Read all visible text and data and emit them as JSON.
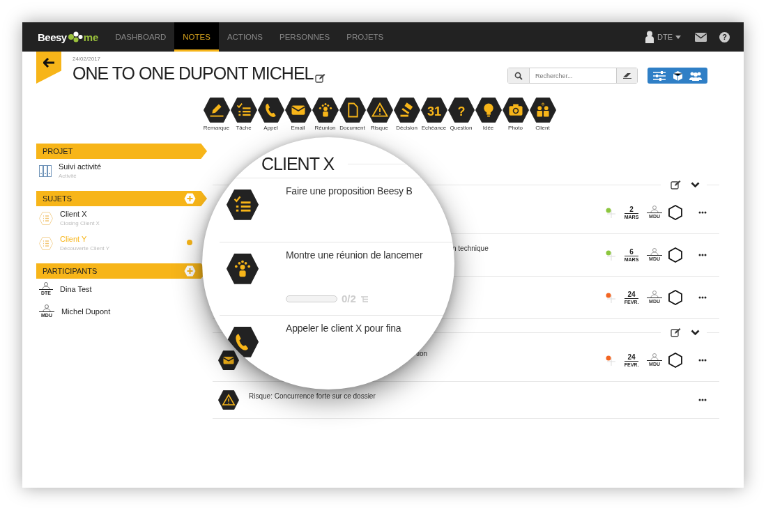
{
  "nav": {
    "logo_left": "Beesy",
    "logo_right": "me",
    "tabs": [
      {
        "label": "DASHBOARD",
        "selected": false
      },
      {
        "label": "NOTES",
        "selected": true
      },
      {
        "label": "ACTIONS",
        "selected": false
      },
      {
        "label": "PERSONNES",
        "selected": false
      },
      {
        "label": "PROJETS",
        "selected": false
      }
    ],
    "user": "DTE",
    "help_glyph": "?"
  },
  "header": {
    "date": "24/02/2017",
    "title": "ONE TO ONE DUPONT MICHEL",
    "search_placeholder": "Rechercher..."
  },
  "note_types": [
    {
      "kind": "remark",
      "label": "Remarque"
    },
    {
      "kind": "task",
      "label": "Tâche"
    },
    {
      "kind": "call",
      "label": "Appel"
    },
    {
      "kind": "email",
      "label": "Email"
    },
    {
      "kind": "meeting",
      "label": "Réunion"
    },
    {
      "kind": "document",
      "label": "Document"
    },
    {
      "kind": "risk",
      "label": "Risque"
    },
    {
      "kind": "decision",
      "label": "Décision"
    },
    {
      "kind": "deadline",
      "label": "Echéance",
      "glyph": "31"
    },
    {
      "kind": "question",
      "label": "Question",
      "glyph": "?"
    },
    {
      "kind": "idea",
      "label": "Idée"
    },
    {
      "kind": "photo",
      "label": "Photo"
    },
    {
      "kind": "client",
      "label": "Client"
    }
  ],
  "sidebar": {
    "sections": [
      {
        "title": "PROJET",
        "addable": false,
        "items": [
          {
            "kind": "project",
            "name": "Suivi activité",
            "subtitle": "Activité",
            "selected": false
          }
        ]
      },
      {
        "title": "SUJETS",
        "addable": true,
        "items": [
          {
            "kind": "subject",
            "name": "Client X",
            "subtitle": "Closing Client X",
            "selected": false
          },
          {
            "kind": "subject",
            "name": "Client Y",
            "subtitle": "Découverte Client Y",
            "selected": true
          }
        ]
      },
      {
        "title": "PARTICIPANTS",
        "addable": true,
        "items": [
          {
            "kind": "participant",
            "initials": "DTE",
            "name": "Dina Test",
            "selected": false
          },
          {
            "kind": "participant",
            "initials": "MDU",
            "name": "Michel Dupont",
            "selected": false
          }
        ]
      }
    ]
  },
  "main": {
    "groups": [
      {
        "rows": [
          {
            "color": "#8cc63e",
            "day": "2",
            "month": "MARS",
            "assignee": "MDU"
          },
          {
            "text": "n technique",
            "color": "#8cc63e",
            "day": "6",
            "month": "MARS",
            "assignee": "MDU"
          },
          {
            "color": "#f26522",
            "day": "24",
            "month": "FEVR.",
            "assignee": "MDU"
          }
        ]
      },
      {
        "rows": [
          {
            "kind": "email",
            "text": "tion",
            "color": "#f26522",
            "day": "24",
            "month": "FEVR.",
            "assignee": "MDU"
          },
          {
            "kind": "risk",
            "text": "Risque: Concurrence forte sur ce dossier"
          }
        ]
      }
    ]
  },
  "lens": {
    "title": "CLIENT X",
    "rows": [
      {
        "kind": "task",
        "text": "Faire une proposition Beesy B"
      },
      {
        "kind": "meeting",
        "text": "Montre une réunion de lancemer",
        "progress": {
          "level": 0,
          "reading": "0/2"
        }
      },
      {
        "kind": "call",
        "text": "Appeler le client X pour fina"
      }
    ]
  }
}
